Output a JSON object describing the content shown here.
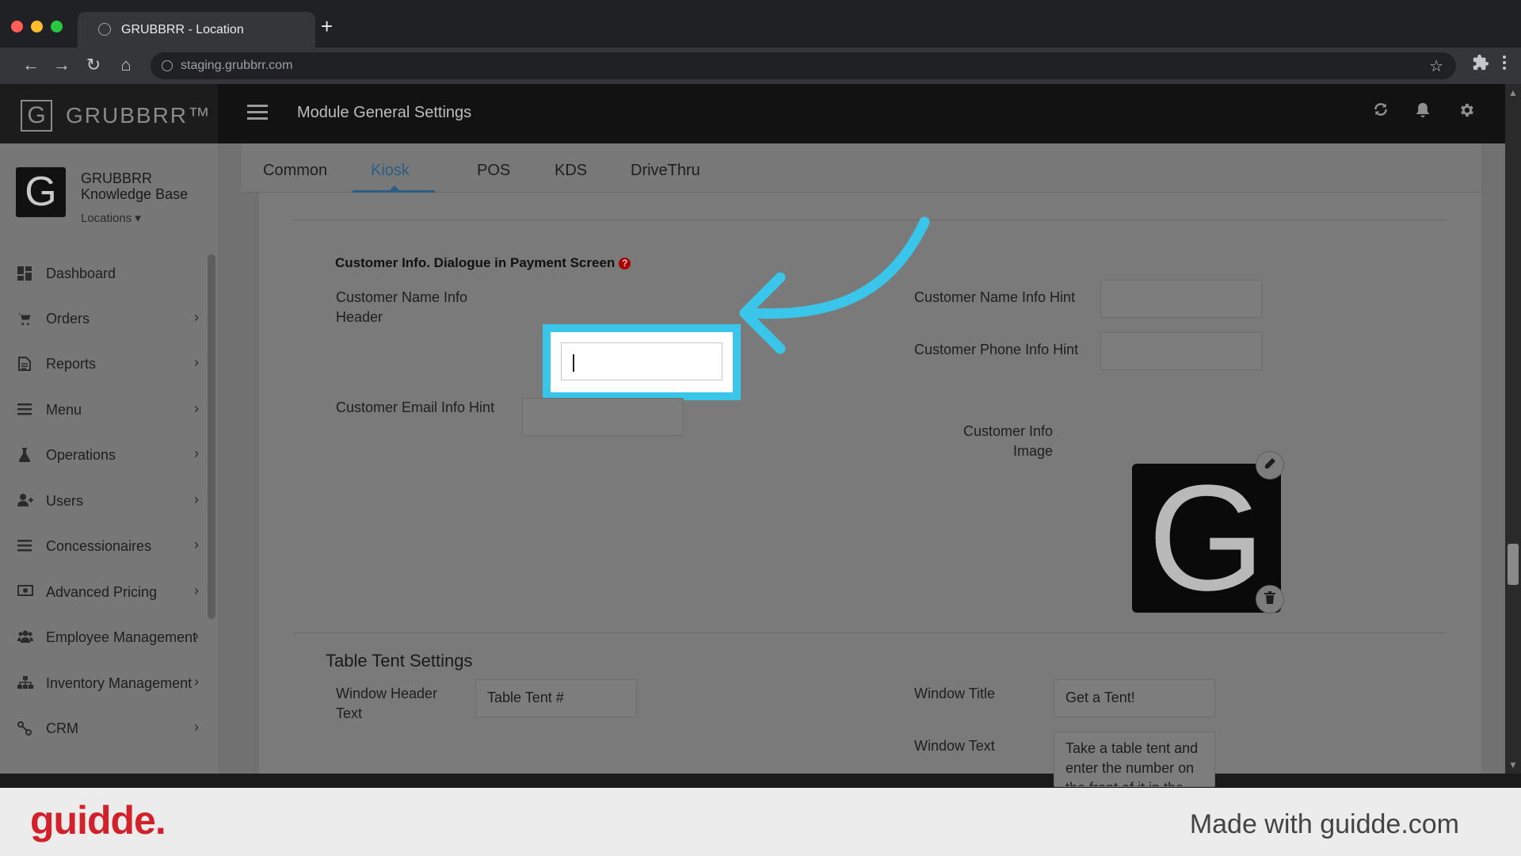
{
  "browser": {
    "tab_title": "GRUBBRR - Location",
    "url": "staging.grubbrr.com",
    "new_tab": "+",
    "back": "←",
    "forward": "→",
    "reload": "↻",
    "home": "⌂",
    "star": "☆"
  },
  "header": {
    "brand_letter": "G",
    "brand_name": "GRUBBRR™",
    "title": "Module General Settings"
  },
  "sidebar": {
    "avatar_letter": "G",
    "org_name": "GRUBBRR Knowledge Base",
    "locations_label": "Locations ▾",
    "items": [
      {
        "label": "Dashboard",
        "icon": "dashboard-icon"
      },
      {
        "label": "Orders",
        "icon": "cart-icon"
      },
      {
        "label": "Reports",
        "icon": "report-icon"
      },
      {
        "label": "Menu",
        "icon": "list-icon"
      },
      {
        "label": "Operations",
        "icon": "flask-icon"
      },
      {
        "label": "Users",
        "icon": "user-plus-icon"
      },
      {
        "label": "Concessionaires",
        "icon": "list-icon"
      },
      {
        "label": "Advanced Pricing",
        "icon": "money-icon"
      },
      {
        "label": "Employee Management",
        "icon": "users-icon"
      },
      {
        "label": "Inventory Management",
        "icon": "sitemap-icon"
      },
      {
        "label": "CRM",
        "icon": "link-icon"
      }
    ]
  },
  "tabs": [
    "Common",
    "Kiosk",
    "POS",
    "KDS",
    "DriveThru"
  ],
  "active_tab": "Kiosk",
  "customer_info": {
    "title": "Customer Info. Dialogue in Payment Screen",
    "help": "?",
    "name_header_label": "Customer Name Info Header",
    "name_header_value": "",
    "email_hint_label": "Customer Email Info Hint",
    "email_hint_value": "",
    "name_hint_label": "Customer Name Info Hint",
    "name_hint_value": "",
    "phone_hint_label": "Customer Phone Info Hint",
    "phone_hint_value": "",
    "image_label": "Customer Info Image",
    "image_letter": "G"
  },
  "table_tent": {
    "title": "Table Tent Settings",
    "header_text_label": "Window Header Text",
    "header_text_value": "Table Tent #",
    "window_title_label": "Window Title",
    "window_title_value": "Get a Tent!",
    "window_text_label": "Window Text",
    "window_text_value": "Take a table tent and enter the number on the front of it in the"
  },
  "footer": {
    "logo": "guidde.",
    "made_with": "Made with guidde.com"
  },
  "colors": {
    "highlight": "#39c6ea",
    "footer_logo": "#d1222c",
    "active_tab": "#2c5d85"
  }
}
